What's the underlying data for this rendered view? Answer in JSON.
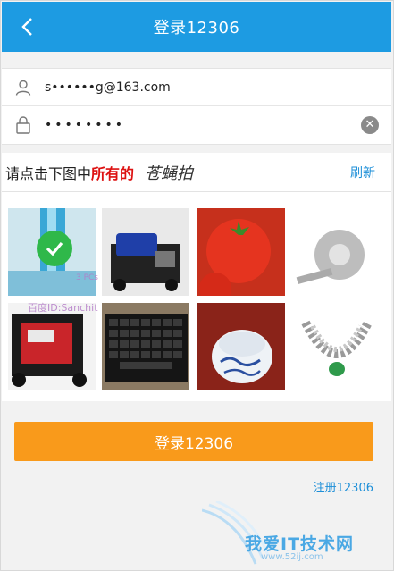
{
  "header": {
    "title": "登录12306",
    "back_icon": "chevron-left-icon"
  },
  "form": {
    "username_value": "s••••••g@163.com",
    "password_value": "••••••••",
    "user_icon": "person-icon",
    "lock_icon": "lock-icon",
    "clear_icon": "clear-icon"
  },
  "captcha": {
    "prompt_prefix": "请点击下图中",
    "prompt_emphasis": "所有的",
    "prompt_target": "苍蝇拍",
    "refresh_label": "刷新",
    "images": [
      {
        "name": "blue-waterfall-image",
        "selected": true
      },
      {
        "name": "generator-image",
        "selected": false
      },
      {
        "name": "tomato-image",
        "selected": false
      },
      {
        "name": "tape-measure-image",
        "selected": false
      },
      {
        "name": "red-generator-image",
        "selected": false
      },
      {
        "name": "keyboard-image",
        "selected": false
      },
      {
        "name": "porcelain-bowl-image",
        "selected": false
      },
      {
        "name": "necklace-image",
        "selected": false
      }
    ],
    "watermark": "百度ID:Sanchit",
    "watermark_small": "3 PCs"
  },
  "login_button_label": "登录12306",
  "register_label": "注册12306",
  "site_mark": {
    "cn": "我爱IT技术网",
    "url": "www.52ij.com"
  },
  "colors": {
    "header": "#1d9be2",
    "button": "#f99a1b",
    "link": "#1d8fd8",
    "emphasis": "#dd1111",
    "check": "#2fb84a"
  }
}
